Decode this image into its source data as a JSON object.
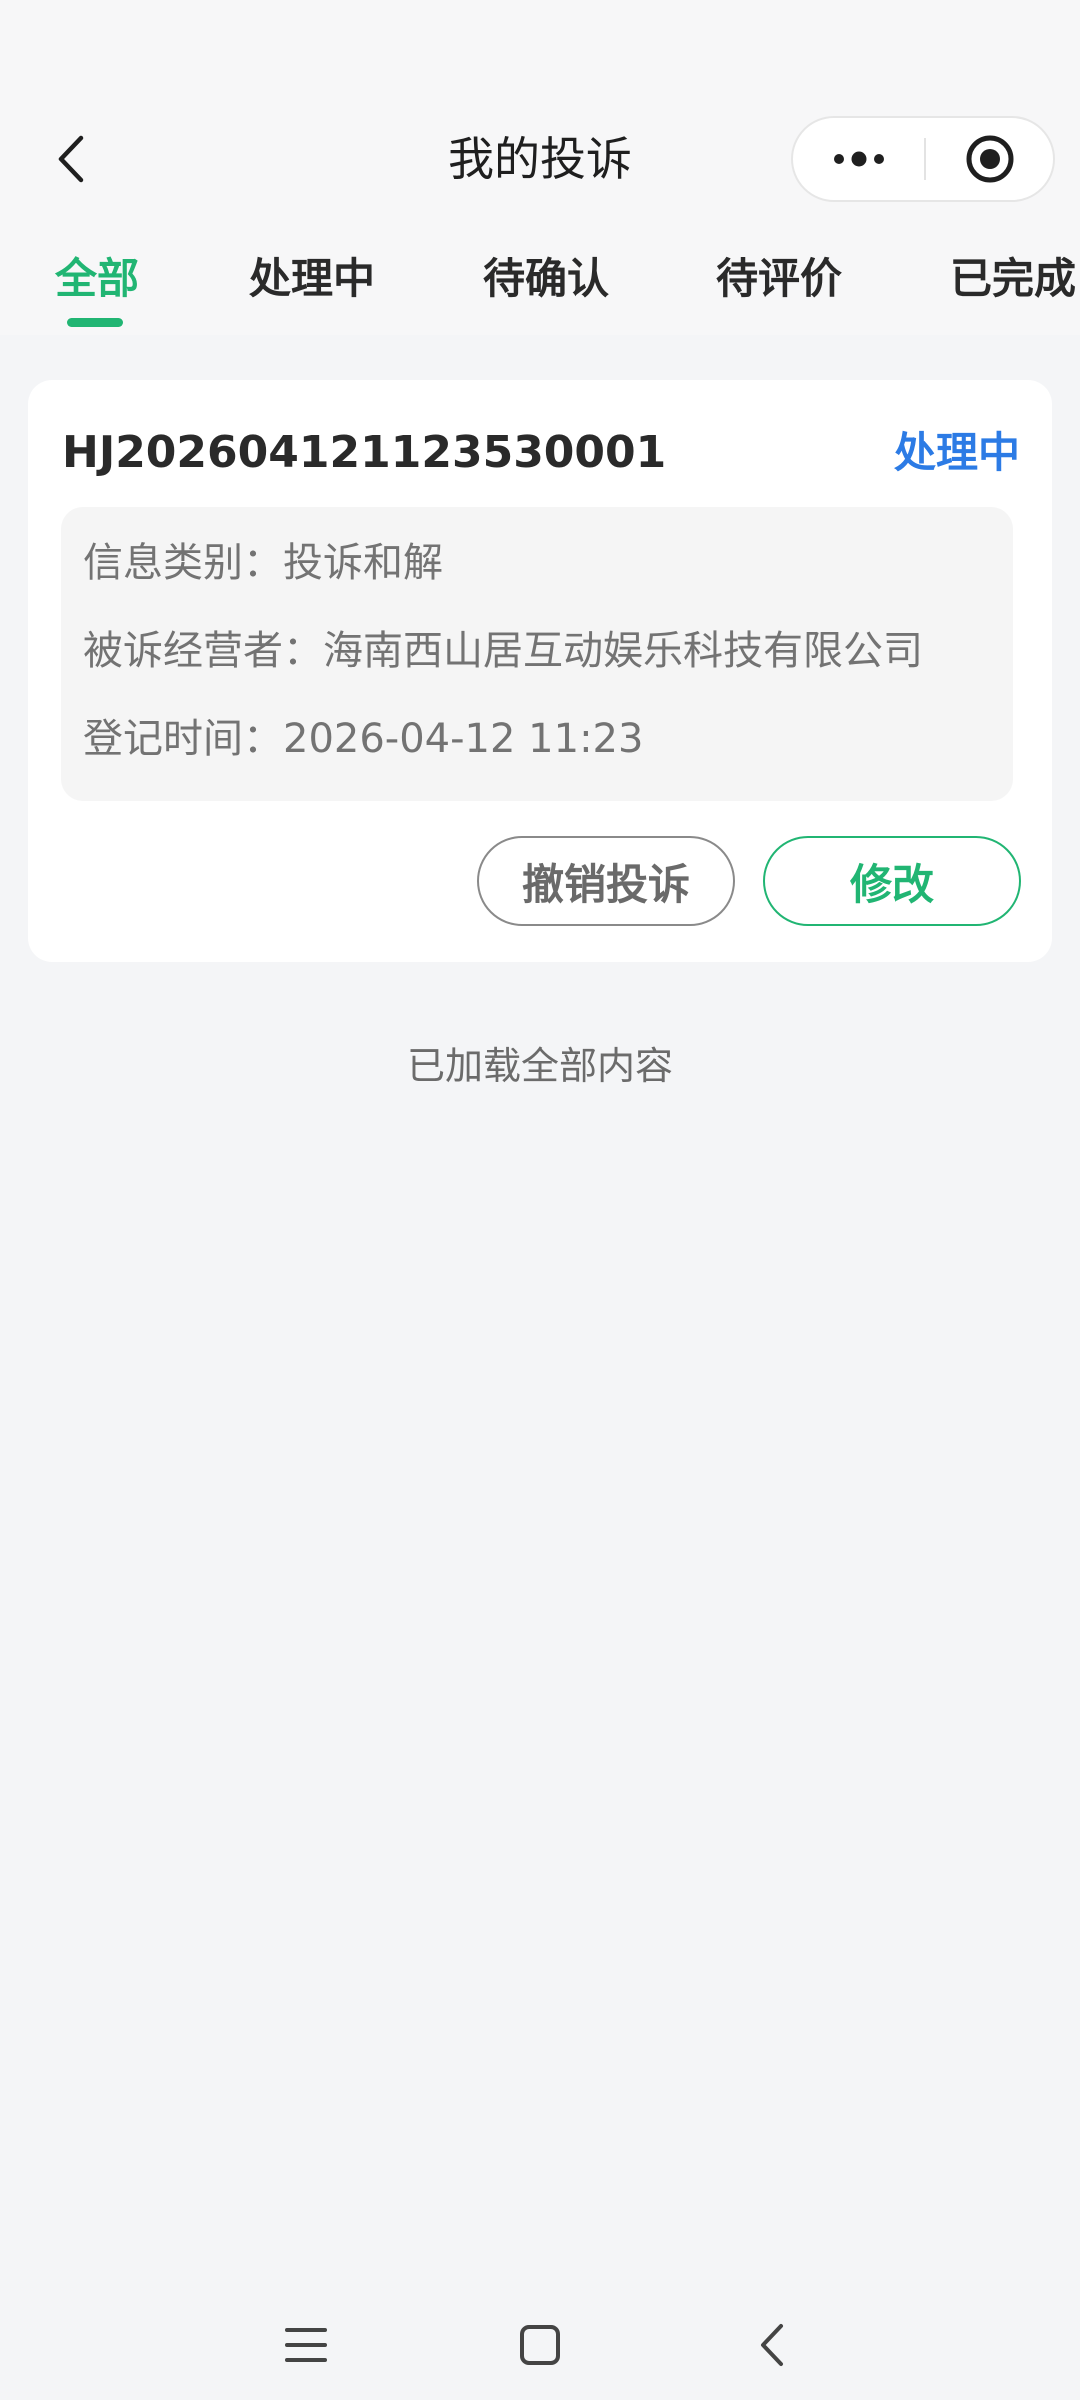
{
  "header": {
    "title": "我的投诉",
    "icons": {
      "back": "chevron-left-icon",
      "more": "more-dots-icon",
      "close": "target-circle-icon"
    }
  },
  "tabs": [
    {
      "label": "全部",
      "active": true
    },
    {
      "label": "处理中",
      "active": false
    },
    {
      "label": "待确认",
      "active": false
    },
    {
      "label": "待评价",
      "active": false
    },
    {
      "label": "已完成",
      "active": false
    }
  ],
  "complaint": {
    "id": "HJ20260412112353000​1",
    "status": "处理中",
    "info": [
      "信息类别：投诉和解",
      "被诉经营者：海南西山居互动娱乐科技有限公司",
      "登记时间：2026-04-12 11:23"
    ],
    "cancel_label": "撤销投诉",
    "edit_label": "修改"
  },
  "footer_text": "已加载全部内容",
  "colors": {
    "accent": "#21b573",
    "status": "#2c7be5",
    "background": "#f4f5f7"
  },
  "navbar": {
    "icons": [
      "menu-icon",
      "home-square-icon",
      "back-chevron-icon"
    ]
  }
}
